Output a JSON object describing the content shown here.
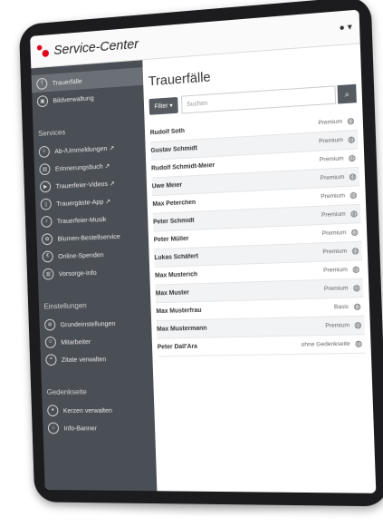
{
  "header": {
    "title": "Service-Center",
    "user_icon": "user-icon",
    "user_caret": "▾"
  },
  "sidebar": {
    "primary": [
      {
        "label": "Trauerfälle",
        "icon": "cross-icon"
      },
      {
        "label": "Bildverwaltung",
        "icon": "image-icon"
      }
    ],
    "services_title": "Services",
    "services": [
      {
        "label": "Ab-/Ummeldungen ↗"
      },
      {
        "label": "Erinnerungsbuch ↗"
      },
      {
        "label": "Trauerfeier-Videos ↗"
      },
      {
        "label": "Trauergäste-App ↗"
      },
      {
        "label": "Trauerfeier-Musik"
      },
      {
        "label": "Blumen-Bestellservice"
      },
      {
        "label": "Online-Spenden"
      },
      {
        "label": "Vorsorge-Info"
      }
    ],
    "settings_title": "Einstellungen",
    "settings": [
      {
        "label": "Grundeinstellungen"
      },
      {
        "label": "Mitarbeiter"
      },
      {
        "label": "Zitate verwalten"
      }
    ],
    "memorial_title": "Gedenkseite",
    "memorial": [
      {
        "label": "Kerzen verwalten"
      },
      {
        "label": "Info-Banner"
      }
    ]
  },
  "main": {
    "title": "Trauerfälle",
    "filter_label": "Filter ▾",
    "search_placeholder": "Suchen",
    "rows": [
      {
        "name": "Rudolf Soth",
        "status": "Premium"
      },
      {
        "name": "Gustav Schmidt",
        "status": "Premium"
      },
      {
        "name": "Rudolf Schmidt-Meier",
        "status": "Premium"
      },
      {
        "name": "Uwe Meier",
        "status": "Premium"
      },
      {
        "name": "Max Peterchen",
        "status": "Premium"
      },
      {
        "name": "Peter Schmidt",
        "status": "Premium"
      },
      {
        "name": "Peter Müller",
        "status": "Premium"
      },
      {
        "name": "Lukas Schäfert",
        "status": "Premium"
      },
      {
        "name": "Max Musterich",
        "status": "Premium"
      },
      {
        "name": "Max Muster",
        "status": "Premium"
      },
      {
        "name": "Max Musterfrau",
        "status": "Basic"
      },
      {
        "name": "Max Mustermann",
        "status": "Premium"
      },
      {
        "name": "Peter Dall'Ara",
        "status": "ohne Gedenkseite"
      }
    ]
  }
}
